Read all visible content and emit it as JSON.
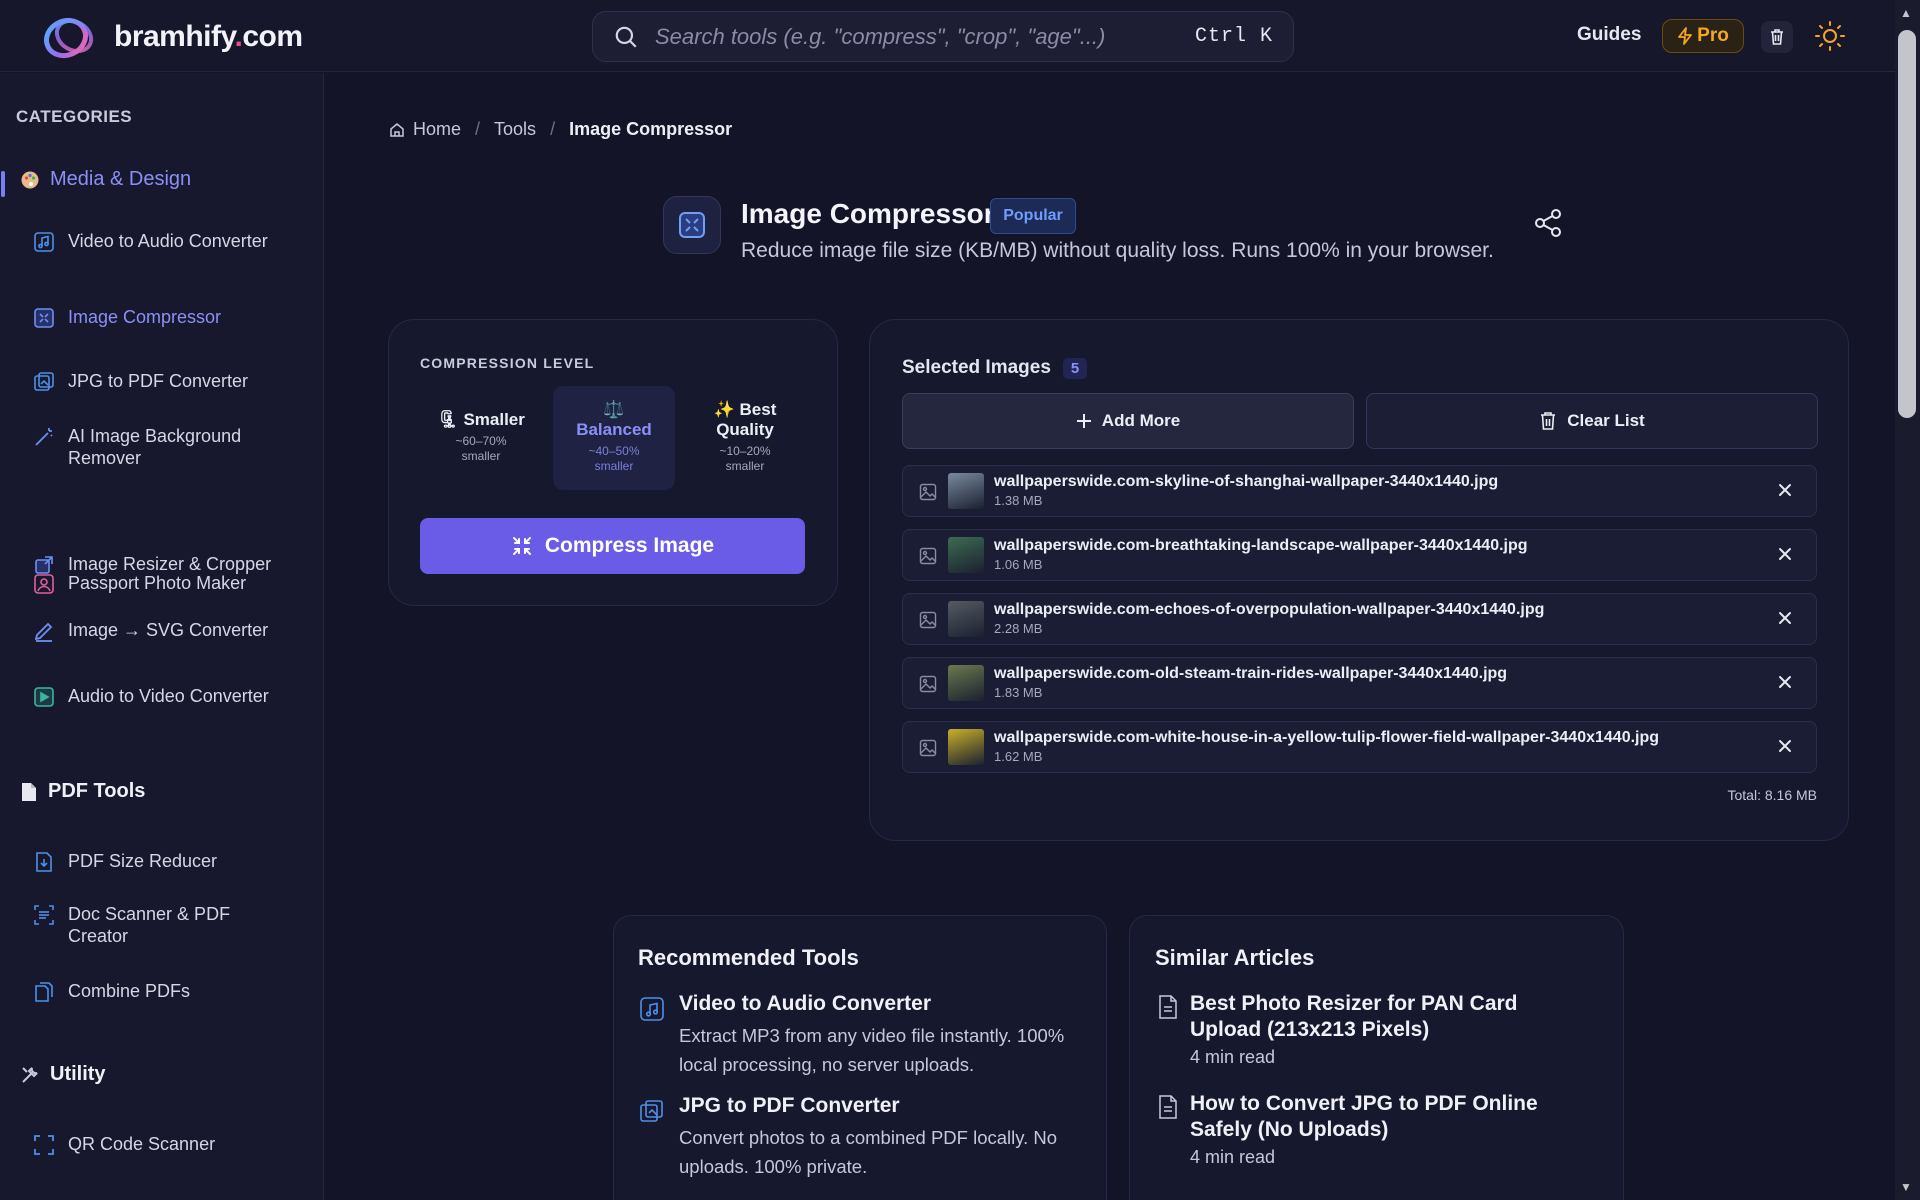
{
  "header": {
    "logo_text_a": "bramhify",
    "logo_text_dot": ".",
    "logo_text_b": "com",
    "search_placeholder": "Search tools (e.g. \"compress\", \"crop\", \"age\"...)",
    "search_shortcut": "Ctrl K",
    "guides_label": "Guides",
    "pro_label": "Pro"
  },
  "sidebar": {
    "title": "CATEGORIES",
    "groups": [
      {
        "label": "Media & Design",
        "icon": "palette-icon",
        "items": [
          {
            "label": "Video to Audio Converter",
            "icon": "music-file-icon"
          },
          {
            "label": "Image Compressor",
            "icon": "image-compress-icon"
          },
          {
            "label": "JPG to PDF Converter",
            "icon": "images-icon"
          },
          {
            "label": "AI Image Background Remover",
            "icon": "magic-wand-icon"
          },
          {
            "label": "Passport Photo Maker",
            "icon": "portrait-icon"
          },
          {
            "label": "Image Resizer & Cropper",
            "icon": "resize-icon"
          },
          {
            "label": "Image → SVG Converter",
            "icon": "pen-icon"
          },
          {
            "label": "Audio to Video Converter",
            "icon": "video-icon"
          }
        ]
      },
      {
        "label": "PDF Tools",
        "icon": "document-icon",
        "items": [
          {
            "label": "PDF Size Reducer",
            "icon": "pdf-down-icon"
          },
          {
            "label": "Doc Scanner & PDF Creator",
            "icon": "scanner-icon"
          },
          {
            "label": "Combine PDFs",
            "icon": "files-icon"
          }
        ]
      },
      {
        "label": "Utility",
        "icon": "tools-icon",
        "items": [
          {
            "label": "QR Code Scanner",
            "icon": "scan-frame-icon"
          }
        ]
      }
    ]
  },
  "breadcrumb": {
    "home": "Home",
    "tools": "Tools",
    "current": "Image Compressor",
    "sep": "/"
  },
  "tool": {
    "title": "Image Compressor",
    "badge": "Popular",
    "description": "Reduce image file size (KB/MB) without quality loss. Runs 100% in your browser."
  },
  "compression": {
    "label": "COMPRESSION LEVEL",
    "options": [
      {
        "emoji": "🗜",
        "title": "Smaller",
        "sub1": "~60–70%",
        "sub2": "smaller"
      },
      {
        "emoji": "⚖️",
        "title": "Balanced",
        "sub1": "~40–50%",
        "sub2": "smaller"
      },
      {
        "emoji": "✨",
        "title": "Best Quality",
        "sub1": "~10–20%",
        "sub2": "smaller"
      }
    ],
    "selected": "Balanced",
    "button": "Compress Image"
  },
  "selected_images": {
    "title": "Selected Images",
    "count": "5",
    "add_more": "Add More",
    "clear_list": "Clear List",
    "files": [
      {
        "name": "wallpaperswide.com-skyline-of-shanghai-wallpaper-3440x1440.jpg",
        "size": "1.38 MB",
        "thumb_color": "#7a8aa0"
      },
      {
        "name": "wallpaperswide.com-breathtaking-landscape-wallpaper-3440x1440.jpg",
        "size": "1.06 MB",
        "thumb_color": "#3d6b52"
      },
      {
        "name": "wallpaperswide.com-echoes-of-overpopulation-wallpaper-3440x1440.jpg",
        "size": "2.28 MB",
        "thumb_color": "#555b62"
      },
      {
        "name": "wallpaperswide.com-old-steam-train-rides-wallpaper-3440x1440.jpg",
        "size": "1.83 MB",
        "thumb_color": "#6b7a4e"
      },
      {
        "name": "wallpaperswide.com-white-house-in-a-yellow-tulip-flower-field-wallpaper-3440x1440.jpg",
        "size": "1.62 MB",
        "thumb_color": "#c9b02a"
      }
    ],
    "total": "Total: 8.16 MB"
  },
  "recommended": {
    "title": "Recommended Tools",
    "items": [
      {
        "title": "Video to Audio Converter",
        "desc": "Extract MP3 from any video file instantly. 100% local processing, no server uploads."
      },
      {
        "title": "JPG to PDF Converter",
        "desc": "Convert photos to a combined PDF locally. No uploads. 100% private."
      }
    ]
  },
  "articles": {
    "title": "Similar Articles",
    "items": [
      {
        "title": "Best Photo Resizer for PAN Card Upload (213x213 Pixels)",
        "meta": "4 min read"
      },
      {
        "title": "How to Convert JPG to PDF Online Safely (No Uploads)",
        "meta": "4 min read"
      }
    ]
  },
  "colors": {
    "accent": "#6a5ce6",
    "accent_text": "#8b8ff8",
    "pro": "#f5a623",
    "background": "#131427"
  }
}
